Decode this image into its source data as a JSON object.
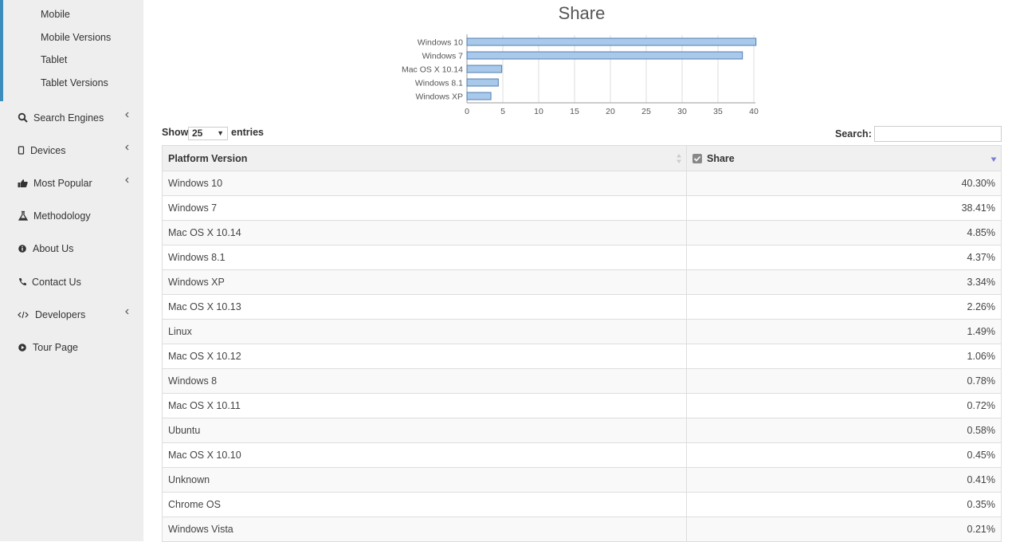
{
  "sidebar": {
    "sub_items": [
      "Mobile",
      "Mobile Versions",
      "Tablet",
      "Tablet Versions"
    ],
    "nav": [
      {
        "label": "Search Engines",
        "icon": "search-icon",
        "chevron": true
      },
      {
        "label": "Devices",
        "icon": "mobile-icon",
        "chevron": true
      },
      {
        "label": "Most Popular",
        "icon": "thumbs-up-icon",
        "chevron": true
      },
      {
        "label": "Methodology",
        "icon": "flask-icon",
        "chevron": false
      },
      {
        "label": "About Us",
        "icon": "info-icon",
        "chevron": false
      },
      {
        "label": "Contact Us",
        "icon": "phone-icon",
        "chevron": false
      },
      {
        "label": "Developers",
        "icon": "code-icon",
        "chevron": true
      },
      {
        "label": "Tour Page",
        "icon": "play-circle-icon",
        "chevron": false
      }
    ]
  },
  "chart_data": {
    "type": "bar",
    "orientation": "horizontal",
    "title": "Share",
    "categories": [
      "Windows 10",
      "Windows 7",
      "Mac OS X 10.14",
      "Windows 8.1",
      "Windows XP"
    ],
    "values": [
      40.3,
      38.41,
      4.85,
      4.37,
      3.34
    ],
    "xticks": [
      "0",
      "5",
      "10",
      "15",
      "20",
      "25",
      "30",
      "35",
      "40"
    ],
    "xlim": [
      0,
      40
    ],
    "grid": true,
    "colors": {
      "bar_fill": "#a9c9ea",
      "bar_stroke": "#4f7db3",
      "grid": "#dddddd"
    }
  },
  "controls": {
    "show_label": "Show",
    "length_value": "25",
    "entries_label": "entries",
    "search_label": "Search:",
    "search_value": ""
  },
  "table": {
    "headers": [
      "Platform Version",
      "Share"
    ],
    "rows": [
      [
        "Windows 10",
        "40.30%"
      ],
      [
        "Windows 7",
        "38.41%"
      ],
      [
        "Mac OS X 10.14",
        "4.85%"
      ],
      [
        "Windows 8.1",
        "4.37%"
      ],
      [
        "Windows XP",
        "3.34%"
      ],
      [
        "Mac OS X 10.13",
        "2.26%"
      ],
      [
        "Linux",
        "1.49%"
      ],
      [
        "Mac OS X 10.12",
        "1.06%"
      ],
      [
        "Windows 8",
        "0.78%"
      ],
      [
        "Mac OS X 10.11",
        "0.72%"
      ],
      [
        "Ubuntu",
        "0.58%"
      ],
      [
        "Mac OS X 10.10",
        "0.45%"
      ],
      [
        "Unknown",
        "0.41%"
      ],
      [
        "Chrome OS",
        "0.35%"
      ],
      [
        "Windows Vista",
        "0.21%"
      ]
    ]
  }
}
